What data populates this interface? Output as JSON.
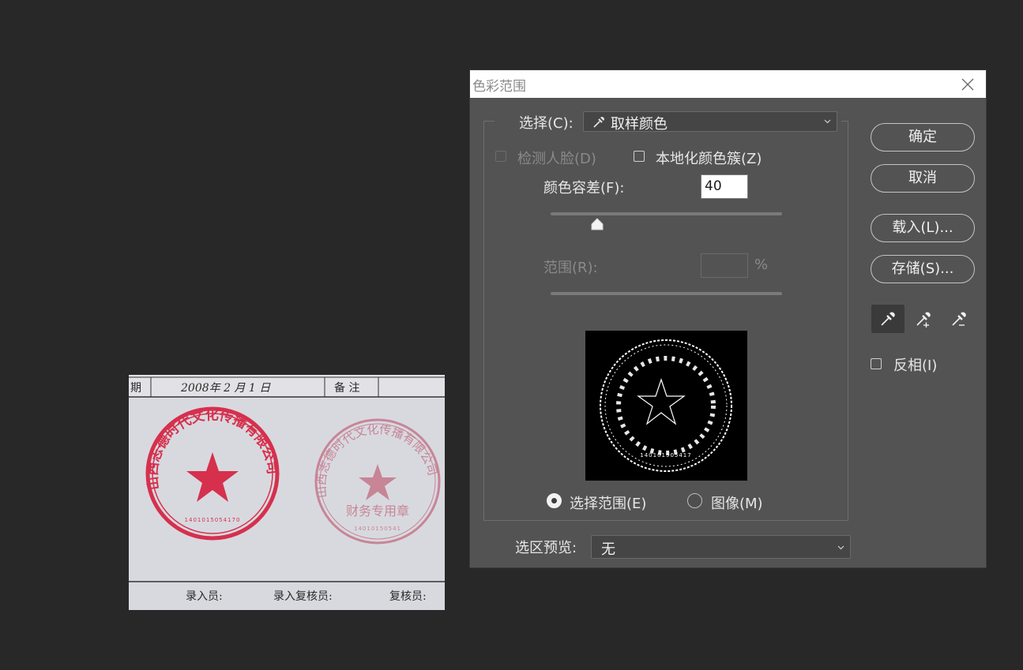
{
  "dialog": {
    "title": "色彩范围",
    "select_label": "选择(C):",
    "select_value": "取样颜色",
    "detect_faces_label": "检测人脸(D)",
    "localized_clusters_label": "本地化颜色簇(Z)",
    "fuzziness_label": "颜色容差(F):",
    "fuzziness_value": "40",
    "fuzziness_level": 0.2,
    "range_label": "范围(R):",
    "range_value": "",
    "range_unit": "%",
    "radio_selection": "选择范围(E)",
    "radio_image": "图像(M)",
    "selection_preview_label": "选区预览:",
    "selection_preview_value": "无",
    "ok": "确定",
    "cancel": "取消",
    "load": "载入(L)...",
    "save": "存储(S)...",
    "invert_label": "反相(I)"
  },
  "document": {
    "date_header": "期",
    "date_text": "2008年 2 月 1 日",
    "remark_header": "备 注",
    "footer_1": "录入员:",
    "footer_2": "录入复核员:",
    "footer_3": "复核员:",
    "stamp_left_text": "山西志德时代文化传播有限公司",
    "stamp_right_text": "山西志德时代文化传播有限公司",
    "stamp_right_sub": "财务专用章"
  },
  "colors": {
    "stamp_red": "#d6304d",
    "stamp_faded": "#c78596",
    "dialog_bg": "#535353",
    "canvas_bg": "#282828"
  }
}
